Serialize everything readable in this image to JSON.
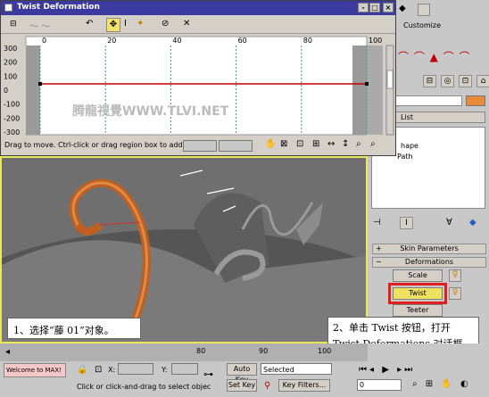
{
  "dialog": {
    "title": "Twist Deformation",
    "controls": {
      "minimize": "-",
      "maximize": "□",
      "close": "×"
    },
    "ruler": [
      "0",
      "20",
      "40",
      "60",
      "80",
      "100"
    ],
    "y_ticks": [
      "300",
      "200",
      "100",
      "0",
      "-100",
      "-200",
      "-300"
    ],
    "status_text": "Drag to move. Ctrl-click or drag region box to add to s",
    "watermark": "腾龍視覺WWW.TLVI.NET"
  },
  "right_panel": {
    "menu_label": "Customize",
    "list_label": "List",
    "stack_items": [
      "hape",
      "Path"
    ],
    "rollouts": {
      "skin_parameters": "Skin Parameters",
      "deformations": "Deformations"
    },
    "buttons": {
      "scale": "Scale",
      "twist": "Twist",
      "teeter": "Teeter"
    }
  },
  "callouts": {
    "left": "1、选择“藤 01”对象。",
    "right_line1": "2、单击 Twist 按钮，打开",
    "right_line2": "Twist Deformations 对话框。"
  },
  "bottom": {
    "timeline_marks": [
      "80",
      "90",
      "100"
    ],
    "maxscript": "Welcome to MAX!",
    "prompt": "Click or click-and-drag to select objec",
    "x_label": "X:",
    "y_label": "Y:",
    "auto_key": "Auto Key",
    "set_key": "Set Key",
    "selected": "Selected",
    "key_filters": "Key Filters...",
    "frame": "0"
  },
  "colors": {
    "curve": "#c00000",
    "highlight": "#e02020",
    "twist_button": "#f0e060"
  }
}
